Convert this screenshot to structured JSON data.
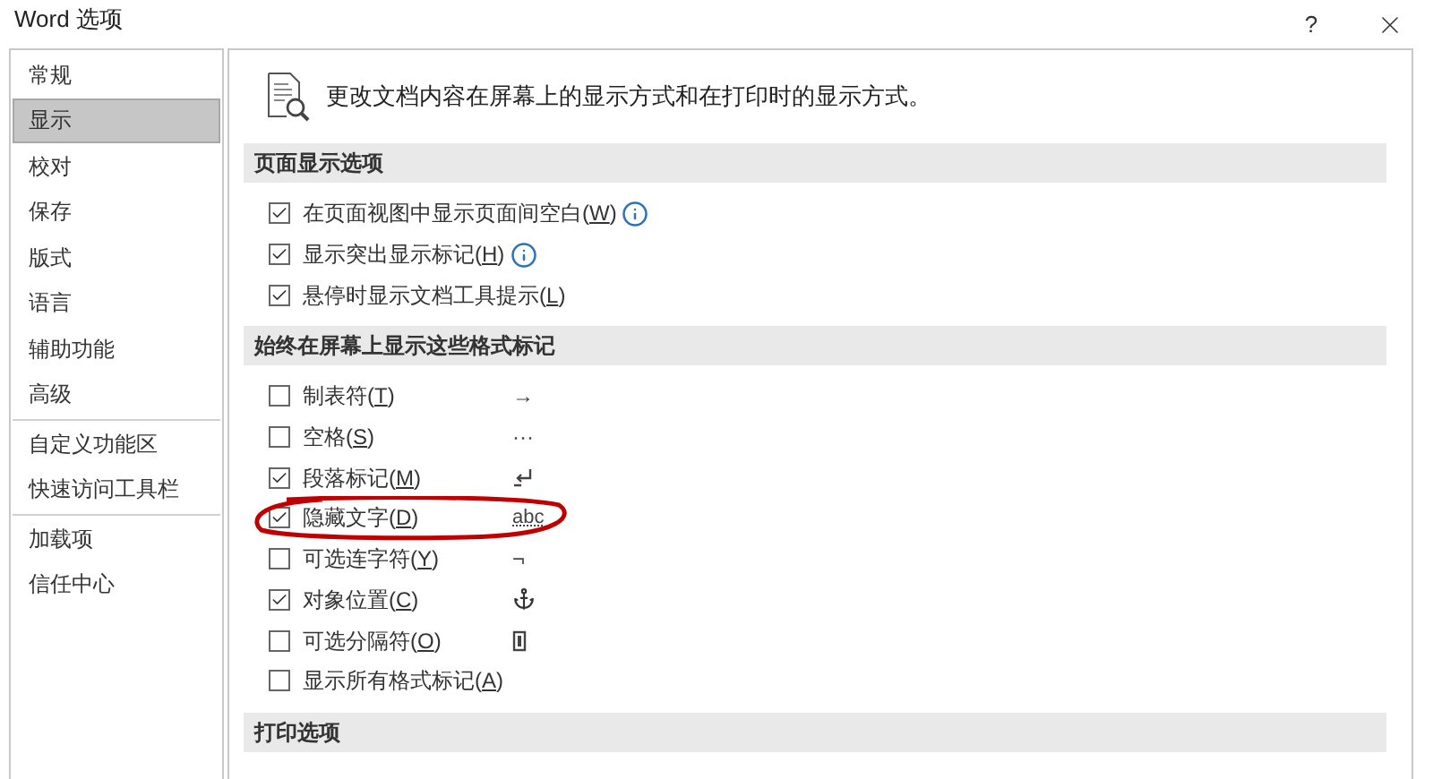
{
  "window": {
    "title": "Word 选项",
    "help": "?"
  },
  "sidebar": {
    "items": [
      {
        "label": "常规",
        "selected": false
      },
      {
        "label": "显示",
        "selected": true
      },
      {
        "label": "校对",
        "selected": false
      },
      {
        "label": "保存",
        "selected": false
      },
      {
        "label": "版式",
        "selected": false
      },
      {
        "label": "语言",
        "selected": false
      },
      {
        "label": "辅助功能",
        "selected": false
      },
      {
        "label": "高级",
        "selected": false,
        "divider_after": true
      },
      {
        "label": "自定义功能区",
        "selected": false
      },
      {
        "label": "快速访问工具栏",
        "selected": false,
        "divider_after": true
      },
      {
        "label": "加载项",
        "selected": false
      },
      {
        "label": "信任中心",
        "selected": false
      }
    ]
  },
  "header": "更改文档内容在屏幕上的显示方式和在打印时的显示方式。",
  "sections": [
    {
      "title": "页面显示选项",
      "options": [
        {
          "label": "在页面视图中显示页面间空白(W)",
          "checked": true,
          "info": true
        },
        {
          "label": "显示突出显示标记(H)",
          "checked": true,
          "info": true
        },
        {
          "label": "悬停时显示文档工具提示(L)",
          "checked": true,
          "info": false
        }
      ]
    },
    {
      "title": "始终在屏幕上显示这些格式标记",
      "options": [
        {
          "label": "制表符(T)",
          "checked": false,
          "kind": "text",
          "symbol": "→"
        },
        {
          "label": "空格(S)",
          "checked": false,
          "kind": "text",
          "symbol": "···"
        },
        {
          "label": "段落标记(M)",
          "checked": true,
          "kind": "paragraph"
        },
        {
          "label": "隐藏文字(D)",
          "checked": true,
          "kind": "hidden",
          "symbol": "abc",
          "circled": true
        },
        {
          "label": "可选连字符(Y)",
          "checked": false,
          "kind": "text",
          "symbol": "¬"
        },
        {
          "label": "对象位置(C)",
          "checked": true,
          "kind": "anchor"
        },
        {
          "label": "可选分隔符(O)",
          "checked": false,
          "kind": "separator"
        },
        {
          "label": "显示所有格式标记(A)",
          "checked": false,
          "kind": "none"
        }
      ]
    },
    {
      "title": "打印选项"
    }
  ]
}
